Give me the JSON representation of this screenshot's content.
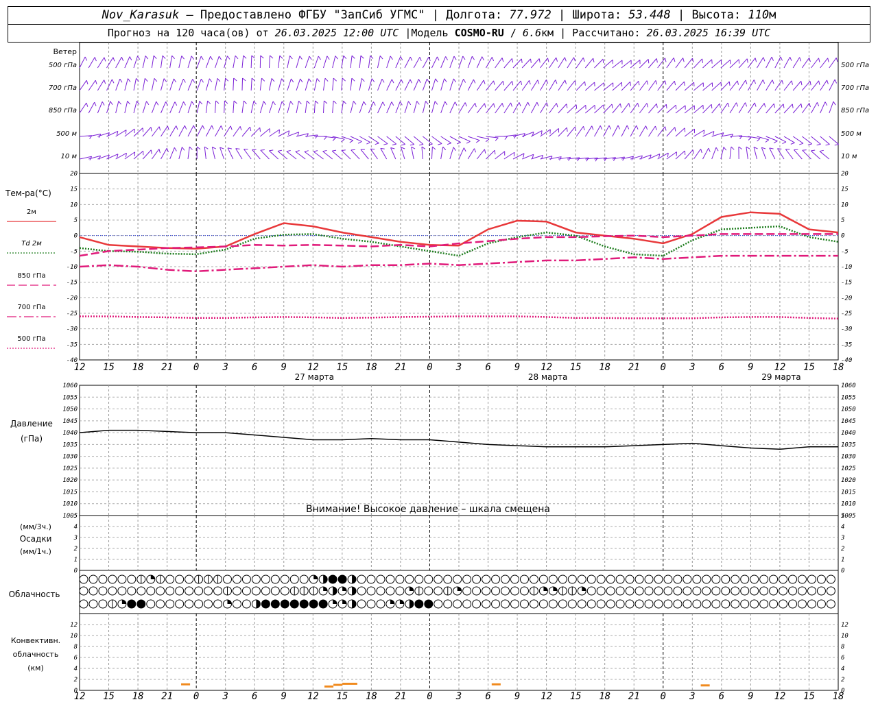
{
  "header": {
    "station": "Nov_Karasuk",
    "provider": "– Предоставлено ФГБУ \"ЗапСиб УГМС\"",
    "lon_label": "Долгота:",
    "lon": "77.972",
    "lat_label": "Широта:",
    "lat": "53.448",
    "alt_label": "Высота:",
    "alt": "110",
    "alt_unit": "м",
    "forecast_label": "Прогноз на 120 часа(ов) от",
    "forecast_from": "26.03.2025 12:00 UTC",
    "model_label": "Модель",
    "model": "COSMO-RU",
    "model_res": "6.6",
    "model_res_unit": "км",
    "computed_label": "Рассчитано:",
    "computed": "26.03.2025 16:39 UTC"
  },
  "time_axis": {
    "hour_labels": [
      "12",
      "15",
      "18",
      "21",
      "0",
      "3",
      "6",
      "9",
      "12",
      "15",
      "18",
      "21",
      "0",
      "3",
      "6",
      "9",
      "12",
      "15",
      "18",
      "21",
      "0",
      "3",
      "6",
      "9",
      "12",
      "15",
      "18"
    ],
    "date_labels": [
      {
        "hour_index": 8,
        "text": "27 марта"
      },
      {
        "hour_index": 16,
        "text": "28 марта"
      },
      {
        "hour_index": 24,
        "text": "29 марта"
      }
    ]
  },
  "wind_panel": {
    "title": "Ветер",
    "levels": [
      "500 гПа",
      "700 гПа",
      "850 гПа",
      "500 м",
      "10 м"
    ],
    "color": "#7a1fd6"
  },
  "chart_data": [
    {
      "type": "line",
      "title": "Тем-ра(°C)",
      "ylim": [
        -40,
        20
      ],
      "yticks": [
        20,
        15,
        10,
        5,
        0,
        -5,
        -10,
        -15,
        -20,
        -25,
        -30,
        -35,
        -40
      ],
      "x_hours_from_start": [
        0,
        6,
        12,
        18,
        24,
        30,
        36,
        42,
        48,
        54,
        60,
        66,
        72,
        78,
        84,
        90,
        96,
        102,
        108,
        114,
        120,
        126
      ],
      "series": [
        {
          "name": "2м",
          "color": "#e8383a",
          "style": "solid",
          "values": [
            -0.5,
            -3,
            -3.5,
            -4,
            -4.2,
            -3.5,
            0.5,
            4,
            3,
            1,
            -0.5,
            -2,
            -3,
            -3.2,
            2,
            4.8,
            4.5,
            1,
            0,
            -1,
            -2.5,
            0.5,
            6,
            7.5,
            7,
            2,
            1
          ]
        },
        {
          "name": "Td 2м",
          "color": "#1e7d1e",
          "style": "dotted",
          "values": [
            -4,
            -5,
            -5.2,
            -5.8,
            -6,
            -4.5,
            -1,
            0.3,
            0.5,
            -1,
            -2,
            -3.5,
            -5,
            -6.5,
            -2.5,
            -0.5,
            1,
            0,
            -3.5,
            -6,
            -6.5,
            -1.5,
            2,
            2.5,
            3,
            -0.5,
            -2
          ]
        },
        {
          "name": "850 гПа",
          "color": "#e01a7a",
          "style": "longdash",
          "values": [
            -6.5,
            -5,
            -4.5,
            -4,
            -3.8,
            -3.5,
            -3,
            -3.2,
            -3,
            -3.2,
            -3.5,
            -3,
            -3.5,
            -2.5,
            -1.8,
            -1,
            -0.5,
            -0.5,
            -0.2,
            0,
            -0.5,
            0,
            0.5,
            0.5,
            0.5,
            0.5,
            0.5
          ]
        },
        {
          "name": "700 гПа",
          "color": "#e01a7a",
          "style": "dashdot",
          "values": [
            -10,
            -9.5,
            -10,
            -11,
            -11.5,
            -11,
            -10.5,
            -10,
            -9.5,
            -10,
            -9.5,
            -9.5,
            -9,
            -9.5,
            -9,
            -8.5,
            -8,
            -8,
            -7.5,
            -7,
            -7.5,
            -7,
            -6.5,
            -6.5,
            -6.5,
            -6.5,
            -6.5
          ]
        },
        {
          "name": "500 гПа",
          "color": "#e01a7a",
          "style": "dotted",
          "values": [
            -26,
            -26,
            -26.2,
            -26.3,
            -26.5,
            -26.5,
            -26.3,
            -26.2,
            -26.3,
            -26.5,
            -26.4,
            -26.2,
            -26.1,
            -26,
            -26,
            -26,
            -26.2,
            -26.5,
            -26.5,
            -26.6,
            -26.6,
            -26.6,
            -26.3,
            -26.2,
            -26.2,
            -26.5,
            -26.7
          ]
        }
      ],
      "zero_line_color": "#3344dd"
    },
    {
      "type": "line",
      "title": "Давление",
      "ylabel": "(гПа)",
      "ylim": [
        1005,
        1060
      ],
      "yticks": [
        1060,
        1055,
        1050,
        1045,
        1040,
        1035,
        1030,
        1025,
        1020,
        1015,
        1010,
        1005
      ],
      "x_hours_from_start": [
        0,
        6,
        12,
        18,
        24,
        30,
        36,
        42,
        48,
        54,
        60,
        66,
        72,
        78,
        84,
        90,
        96,
        102,
        108,
        114,
        120,
        126
      ],
      "series": [
        {
          "name": "",
          "color": "#000000",
          "style": "solid",
          "values": [
            1040,
            1041,
            1041,
            1040.5,
            1040,
            1040,
            1039,
            1038,
            1037,
            1037,
            1037.5,
            1037,
            1037,
            1036,
            1035,
            1034.5,
            1034,
            1034,
            1034,
            1034.5,
            1035,
            1035.5,
            1034.5,
            1033.5,
            1033,
            1034,
            1034
          ]
        }
      ],
      "note": "Внимание! Высокое давление – шкала смещена"
    },
    {
      "type": "bar",
      "title": "Осадки",
      "ylabel_top": "(мм/3ч.)",
      "ylabel_bottom": "(мм/1ч.)",
      "ylim": [
        0,
        5
      ],
      "yticks": [
        5,
        4,
        3,
        2,
        1,
        0
      ],
      "values": []
    },
    {
      "type": "table",
      "title": "Облачность",
      "rows": [
        "000000121000111000000000234430000000000000000000000000000000000000000000000000000000000000000000000000000000000000000000000000",
        "000000000000000100000011123230000021001200000001221120000000000000000000000000000000000000000000000000000000000000000000000000",
        "000124400000000200344444442230002234400000000000000000000000000000000000000000000000000000000000000000000000000000000000000000"
      ]
    },
    {
      "type": "bar",
      "title": "Конвективн. облачность",
      "ylabel": "(км)",
      "ylim": [
        0,
        14
      ],
      "yticks": [
        12,
        10,
        8,
        6,
        4,
        2,
        0
      ],
      "color": "#f08a1e",
      "bars": [
        {
          "hour_start": 17.0,
          "hour_end": 18.5,
          "base_km": 1.1
        },
        {
          "hour_start": 41.0,
          "hour_end": 42.5,
          "base_km": 0.7
        },
        {
          "hour_start": 42.5,
          "hour_end": 44.0,
          "base_km": 1.0
        },
        {
          "hour_start": 44.0,
          "hour_end": 46.5,
          "base_km": 1.2
        },
        {
          "hour_start": 69.0,
          "hour_end": 70.5,
          "base_km": 1.1
        },
        {
          "hour_start": 104.0,
          "hour_end": 105.5,
          "base_km": 0.9
        }
      ]
    }
  ]
}
